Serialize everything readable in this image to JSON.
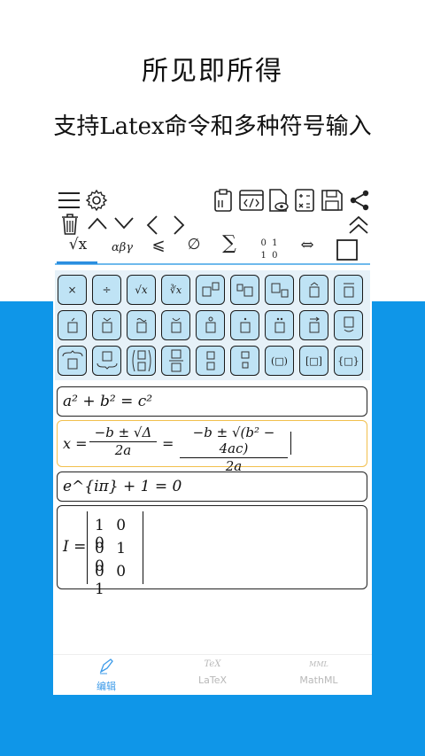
{
  "headline": "所见即所得",
  "subheadline": "支持Latex命令和多种符号输入",
  "toolbar": {
    "icons": [
      "menu-icon",
      "gear-icon",
      "clipboard-icon",
      "code-icon",
      "preview-file-icon",
      "calculator-icon",
      "save-icon",
      "share-icon",
      "trash-icon",
      "chevron-up-icon",
      "chevron-down-icon",
      "chevron-left-icon",
      "chevron-right-icon",
      "double-chevron-up-icon"
    ]
  },
  "symbol_tabs": [
    "√x",
    "αβγ",
    "⩽",
    "∅",
    "∑",
    "0 1 / 1 0",
    "⇔",
    "□"
  ],
  "keyboard_rows": [
    [
      "×",
      "÷",
      "√x",
      "∛x",
      "□^□",
      "□ □",
      "□_□",
      "□̂",
      "□̄"
    ],
    [
      "□́",
      "□̌",
      "□̃",
      "□̆",
      "□̊",
      "□̇",
      "□̈",
      "□⃗",
      "□ˇ"
    ],
    [
      "⏞□",
      "⏟□",
      "(□/□)",
      "□/□",
      "□ □",
      "□ □",
      "(□)",
      "[□]",
      "{□}"
    ]
  ],
  "equations": {
    "eq1": "a² + b² = c²",
    "eq2_lhs": "x =",
    "eq2_frac1_num": "−b ± √Δ",
    "eq2_frac1_den": "2a",
    "eq2_eq": "=",
    "eq2_frac2_num": "−b ± √(b² − 4ac)",
    "eq2_frac2_den": "2a",
    "eq3": "e^{iπ} + 1 = 0",
    "eq4_lhs": "I =",
    "matrix": [
      [
        "1",
        "0",
        "0"
      ],
      [
        "0",
        "1",
        "0"
      ],
      [
        "0",
        "0",
        "1"
      ]
    ]
  },
  "bottom_nav": [
    {
      "label": "编辑",
      "icon": "pen-icon",
      "active": true
    },
    {
      "label": "LaTeX",
      "icon": "TeX",
      "active": false
    },
    {
      "label": "MathML",
      "icon": "MML",
      "active": false
    }
  ],
  "colors": {
    "accent_blue": "#0f96e8",
    "key_fill": "#bfe3f5",
    "active_border": "#f2c04d",
    "nav_active": "#3d9be9"
  }
}
